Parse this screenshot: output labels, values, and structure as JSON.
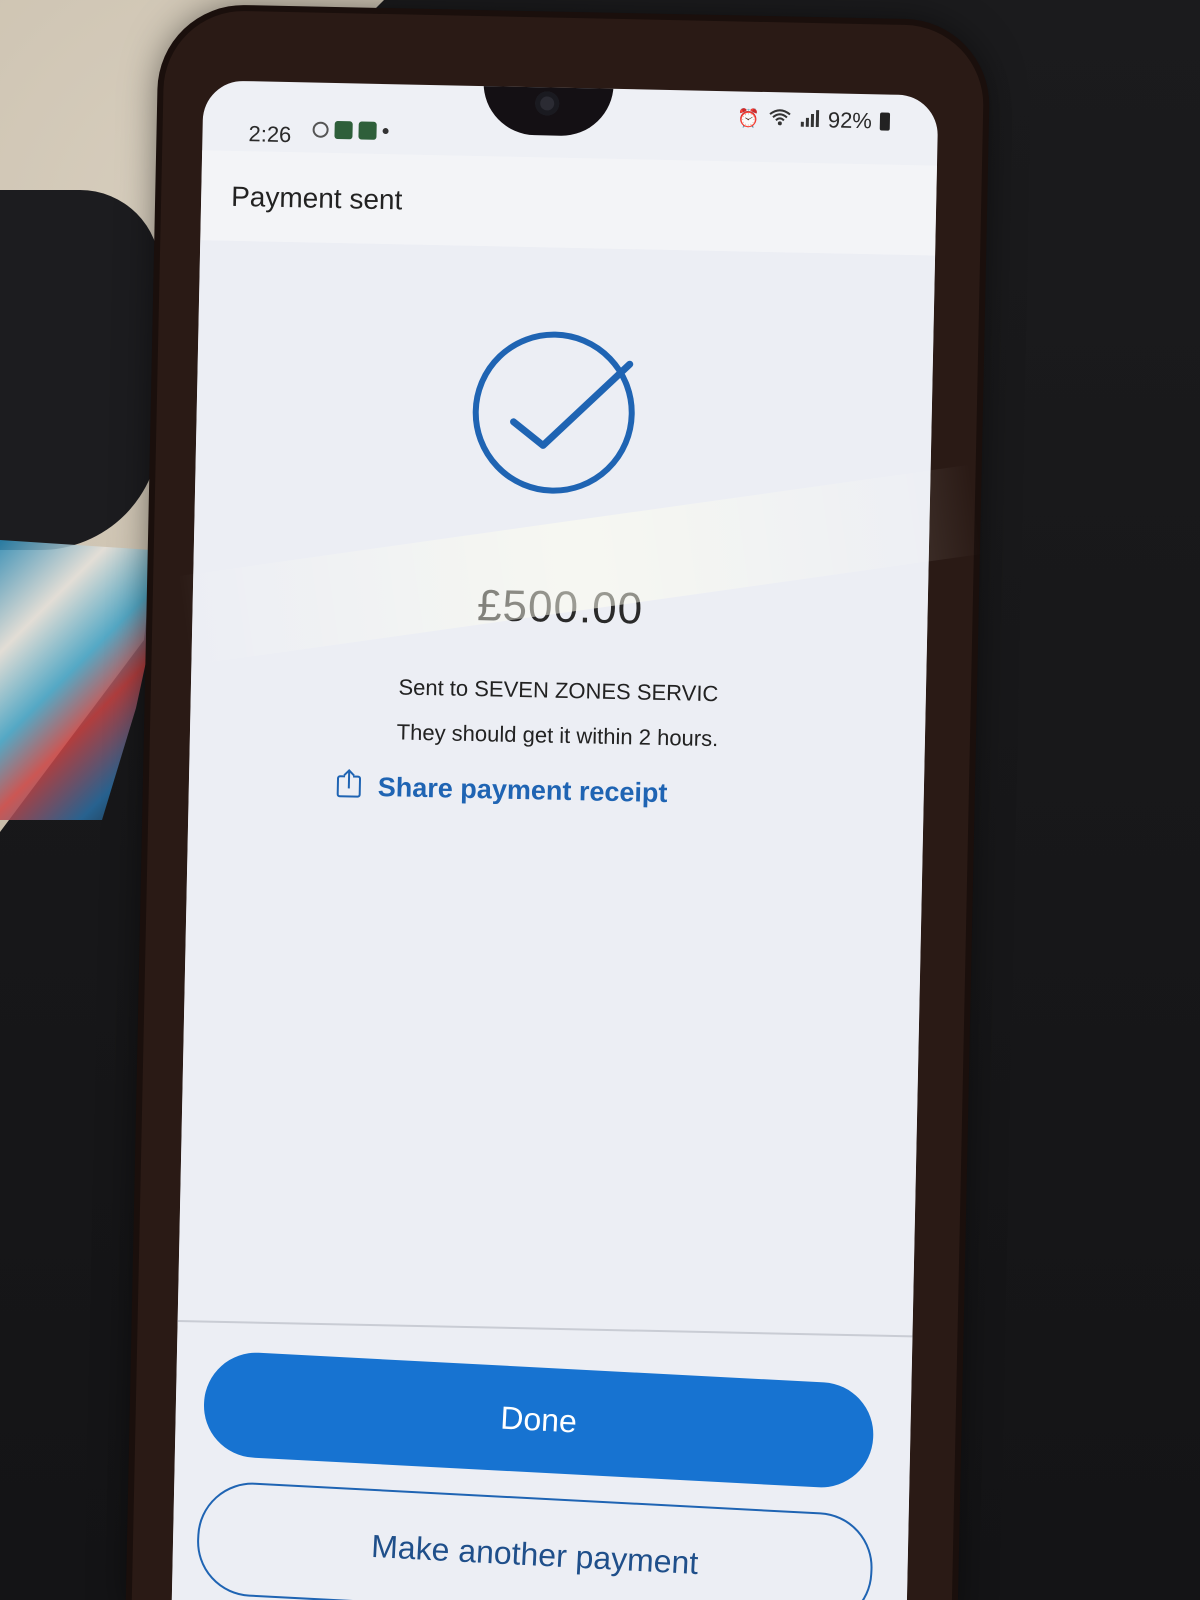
{
  "status_bar": {
    "time": "2:26",
    "battery": "92%",
    "icons_left": [
      "tiktok-icon",
      "app-icon",
      "app-icon",
      "dot"
    ],
    "icons_right": [
      "alarm-icon",
      "wifi-icon",
      "signal-icon",
      "battery-icon"
    ]
  },
  "header": {
    "title": "Payment sent"
  },
  "confirmation": {
    "icon": "checkmark-circle-icon",
    "amount": "£500.00",
    "recipient_line": "Sent to SEVEN ZONES SERVIC",
    "eta_line": "They should get it within 2 hours.",
    "share_label": "Share payment receipt"
  },
  "actions": {
    "done_label": "Done",
    "another_label": "Make another payment"
  },
  "colors": {
    "accent": "#1773d1",
    "link": "#1f64b3",
    "background": "#eceef4"
  }
}
